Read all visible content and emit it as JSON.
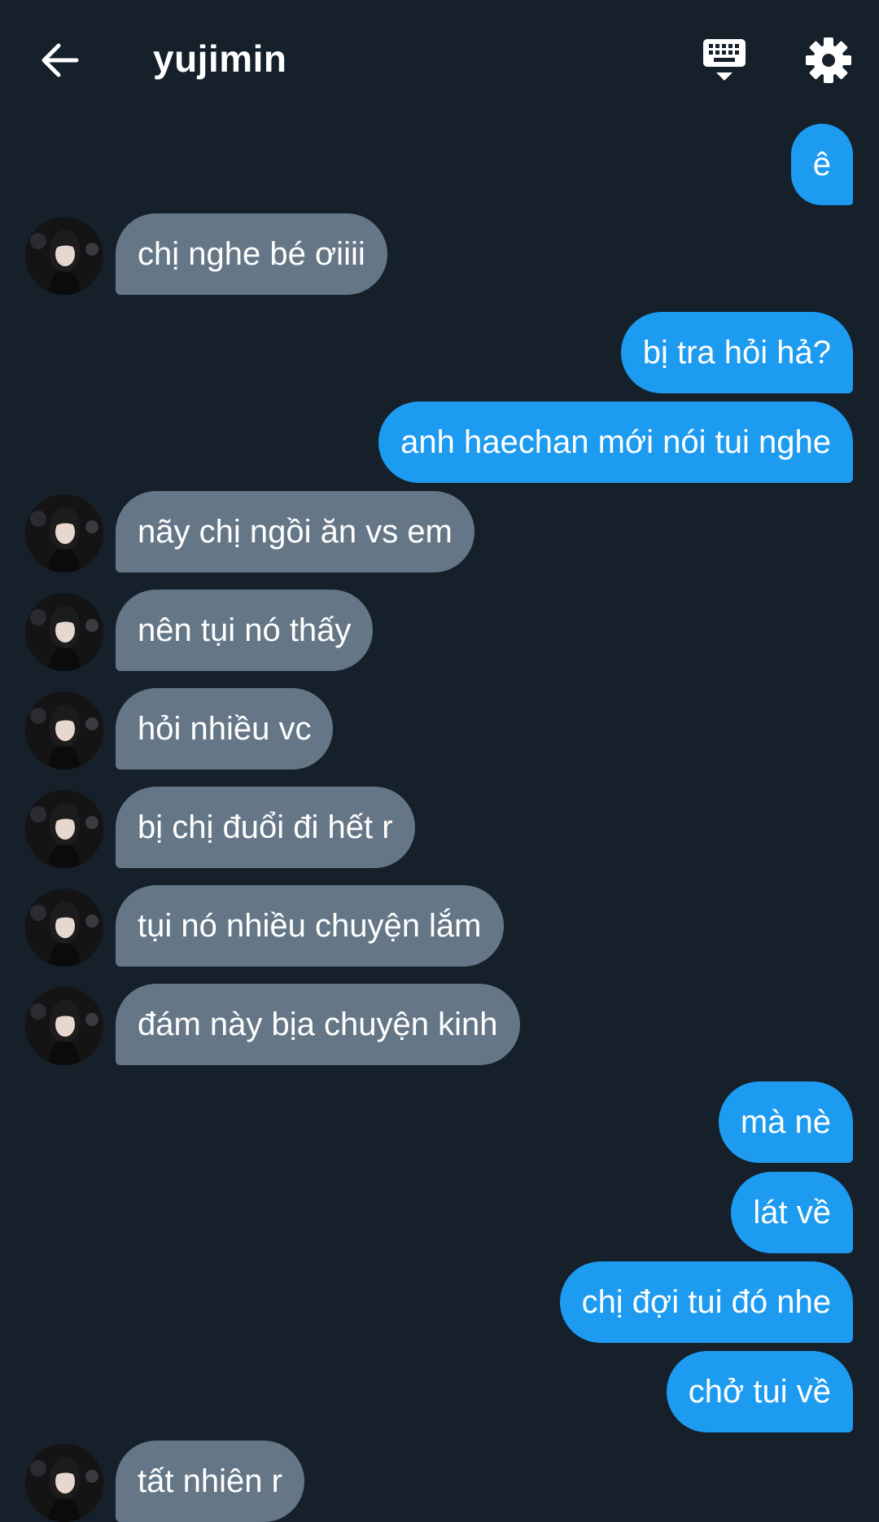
{
  "header": {
    "title": "yujimin",
    "back_icon": "arrow-left-icon",
    "keyboard_icon": "keyboard-hide-icon",
    "settings_icon": "gear-icon"
  },
  "colors": {
    "background": "#15202b",
    "sent_bubble": "#1d9bf0",
    "received_bubble": "#657786",
    "text": "#ffffff"
  },
  "messages": [
    {
      "dir": "sent",
      "text": "ê"
    },
    {
      "dir": "recv",
      "text": "chị nghe bé ơiiii"
    },
    {
      "dir": "sent",
      "text": "bị tra hỏi hả?"
    },
    {
      "dir": "sent",
      "text": "anh haechan mới nói tui nghe"
    },
    {
      "dir": "recv",
      "text": "nãy chị ngồi ăn vs em"
    },
    {
      "dir": "recv",
      "text": "nên tụi nó thấy"
    },
    {
      "dir": "recv",
      "text": "hỏi nhiều vc"
    },
    {
      "dir": "recv",
      "text": "bị chị đuổi đi hết r"
    },
    {
      "dir": "recv",
      "text": "tụi nó nhiều chuyện lắm"
    },
    {
      "dir": "recv",
      "text": "đám này bịa chuyện kinh"
    },
    {
      "dir": "sent",
      "text": "mà nè"
    },
    {
      "dir": "sent",
      "text": "lát về"
    },
    {
      "dir": "sent",
      "text": "chị đợi tui đó nhe"
    },
    {
      "dir": "sent",
      "text": "chở tui về"
    },
    {
      "dir": "recv",
      "text": "tất nhiên r"
    }
  ]
}
